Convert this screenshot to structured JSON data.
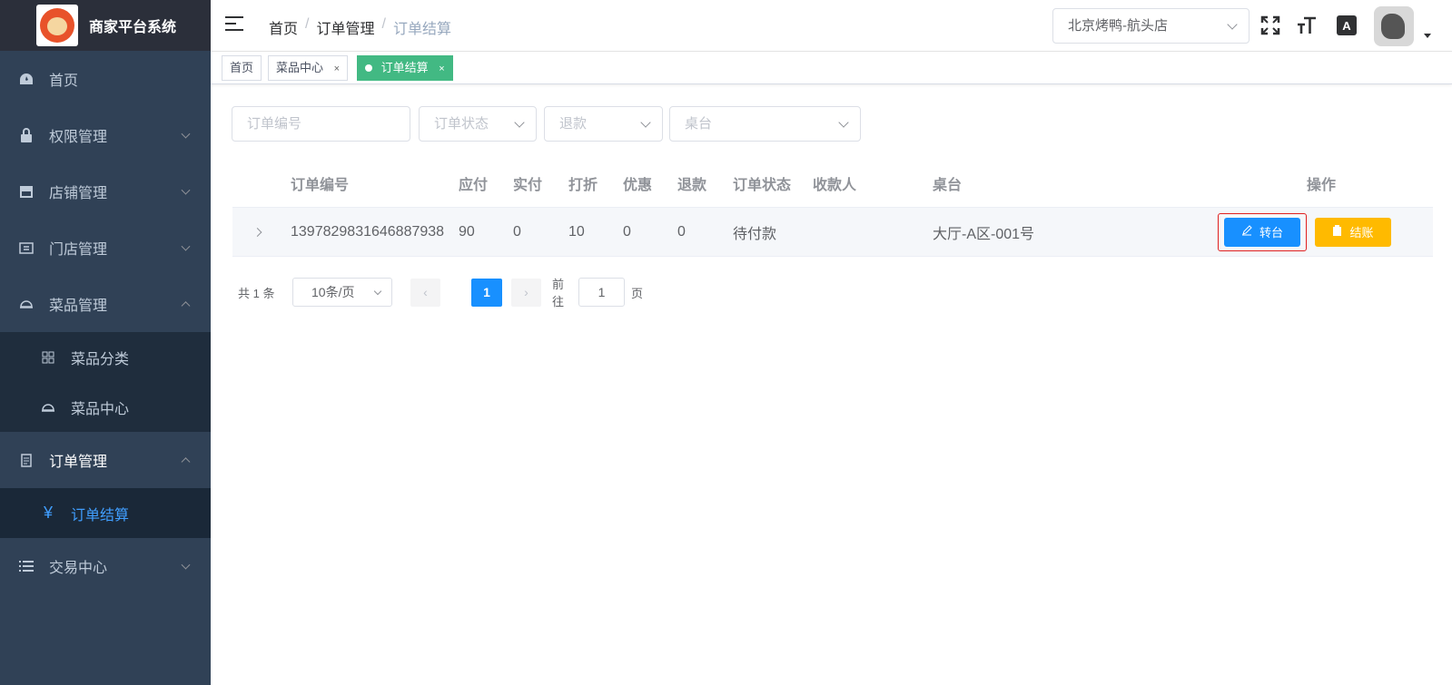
{
  "app": {
    "title": "商家平台系统"
  },
  "sidebar": {
    "items": [
      {
        "label": "首页",
        "icon": "dashboard-icon"
      },
      {
        "label": "权限管理",
        "icon": "lock-icon"
      },
      {
        "label": "店铺管理",
        "icon": "shop-icon"
      },
      {
        "label": "门店管理",
        "icon": "store-icon"
      },
      {
        "label": "菜品管理",
        "icon": "dish-icon"
      },
      {
        "label": "订单管理",
        "icon": "document-icon"
      },
      {
        "label": "交易中心",
        "icon": "list-icon"
      }
    ],
    "dish_children": [
      {
        "label": "菜品分类",
        "icon": "grid-icon"
      },
      {
        "label": "菜品中心",
        "icon": "dish-icon"
      }
    ],
    "order_children": [
      {
        "label": "订单结算",
        "icon": "yen-icon"
      }
    ]
  },
  "breadcrumb": [
    "首页",
    "订单管理",
    "订单结算"
  ],
  "header": {
    "store_selected": "北京烤鸭-航头店"
  },
  "tags": [
    {
      "label": "首页"
    },
    {
      "label": "菜品中心"
    },
    {
      "label": "订单结算"
    }
  ],
  "filters": {
    "order_no_placeholder": "订单编号",
    "status_placeholder": "订单状态",
    "refund_placeholder": "退款",
    "table_placeholder": "桌台"
  },
  "table": {
    "columns": [
      "订单编号",
      "应付",
      "实付",
      "打折",
      "优惠",
      "退款",
      "订单状态",
      "收款人",
      "桌台",
      "操作"
    ],
    "rows": [
      {
        "order_no": "1397829831646887938",
        "payable": "90",
        "paid": "0",
        "discount": "10",
        "coupon": "0",
        "refund": "0",
        "status": "待付款",
        "cashier": "",
        "table": "大厅-A区-001号",
        "actions": {
          "transfer": "转台",
          "checkout": "结账"
        }
      }
    ]
  },
  "pagination": {
    "total": "共 1 条",
    "page_size": "10条/页",
    "current": "1",
    "goto_label": "前往",
    "goto_value": "1",
    "page_suffix": "页"
  },
  "colors": {
    "sidebar_bg": "#304156",
    "primary": "#1890ff",
    "warning": "#ffba00",
    "tag_active": "#42b983"
  }
}
